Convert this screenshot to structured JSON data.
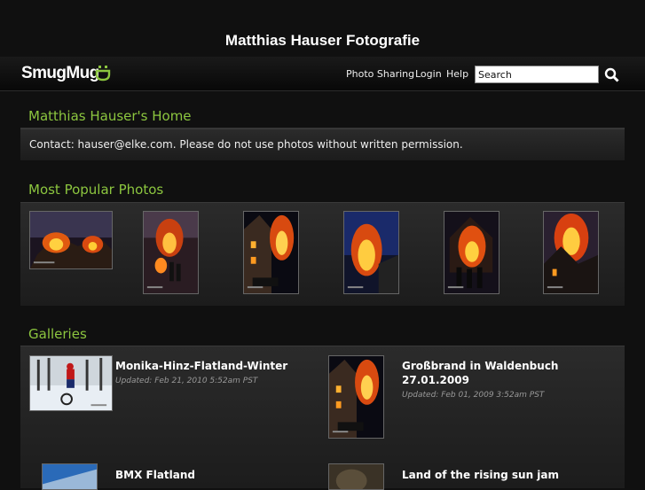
{
  "site": {
    "title": "Matthias Hauser Fotografie"
  },
  "topbar": {
    "logo": "SmugMug",
    "nav": {
      "photo_sharing": "Photo Sharing",
      "login": "Login",
      "help": "Help"
    },
    "search": {
      "value": "Search"
    }
  },
  "home": {
    "title": "Matthias Hauser's Home",
    "contact": "Contact: hauser@elke.com. Please do not use photos without written permission."
  },
  "popular": {
    "title": "Most Popular Photos",
    "photos": [
      {
        "icon": "fire-photo-landscape"
      },
      {
        "icon": "fire-photo-portrait"
      },
      {
        "icon": "fire-photo-portrait"
      },
      {
        "icon": "fire-photo-portrait"
      },
      {
        "icon": "fire-photo-portrait"
      },
      {
        "icon": "fire-photo-portrait"
      }
    ]
  },
  "galleries": {
    "title": "Galleries",
    "items": [
      {
        "title": "Monika-Hinz-Flatland-Winter",
        "updated": "Updated: Feb 21, 2010 5:52am PST"
      },
      {
        "title": "Großbrand in Waldenbuch 27.01.2009",
        "updated": "Updated: Feb 01, 2009 3:52am PST"
      },
      {
        "title": "BMX Flatland",
        "updated": ""
      },
      {
        "title": "Land of the rising sun jam",
        "updated": ""
      }
    ]
  },
  "colors": {
    "accent": "#8cc63f",
    "background": "#101010",
    "panel": "#262626"
  }
}
